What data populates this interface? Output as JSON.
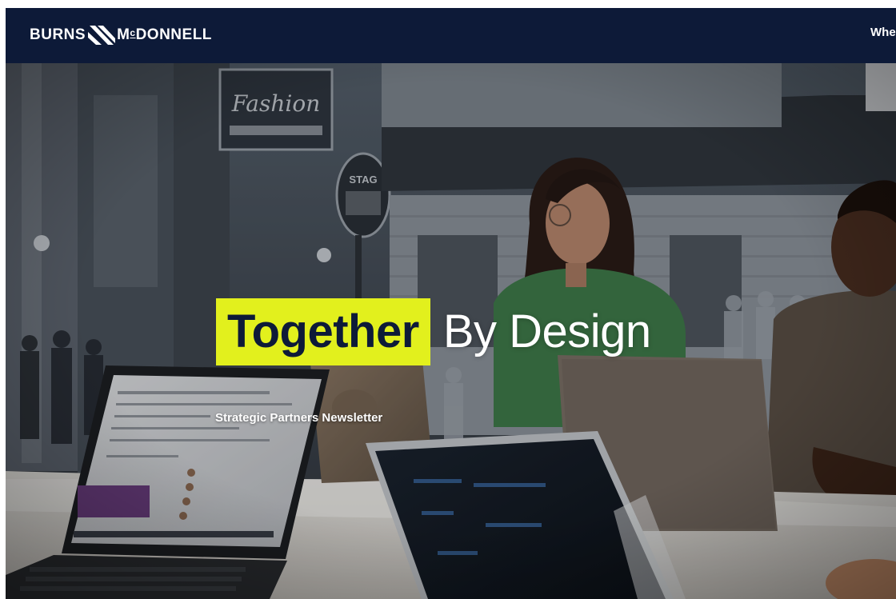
{
  "header": {
    "logo": {
      "text_left": "BURNS",
      "text_mc_m": "M",
      "text_mc_c": "c",
      "text_right": "DONNELL"
    },
    "nav_link": "Whe"
  },
  "hero": {
    "title_highlight": "Together",
    "title_rest": "By Design",
    "subtitle": "Strategic Partners Newsletter"
  },
  "colors": {
    "nav_background": "#0d1a38",
    "highlight": "#e2f01d",
    "title_dark": "#0d1a38",
    "text_light": "#ffffff"
  },
  "icons": {
    "logo_mark": "diagonal-stripes-logo-mark"
  }
}
